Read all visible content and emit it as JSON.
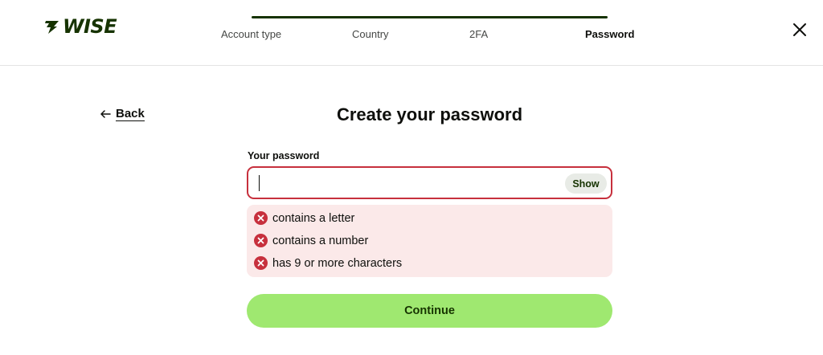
{
  "brand": {
    "name": "WISE",
    "color": "#163300",
    "accent": "#9fe870"
  },
  "stepper": {
    "steps": [
      "Account type",
      "Country",
      "2FA",
      "Password"
    ],
    "active_index": 3
  },
  "nav": {
    "back_label": "Back",
    "close_icon": "close-icon"
  },
  "form": {
    "title": "Create your password",
    "password_label": "Your password",
    "password_value": "",
    "show_label": "Show",
    "error_color": "#c7303d",
    "requirements": [
      "contains a letter",
      "contains a number",
      "has 9 or more characters"
    ],
    "continue_label": "Continue"
  }
}
